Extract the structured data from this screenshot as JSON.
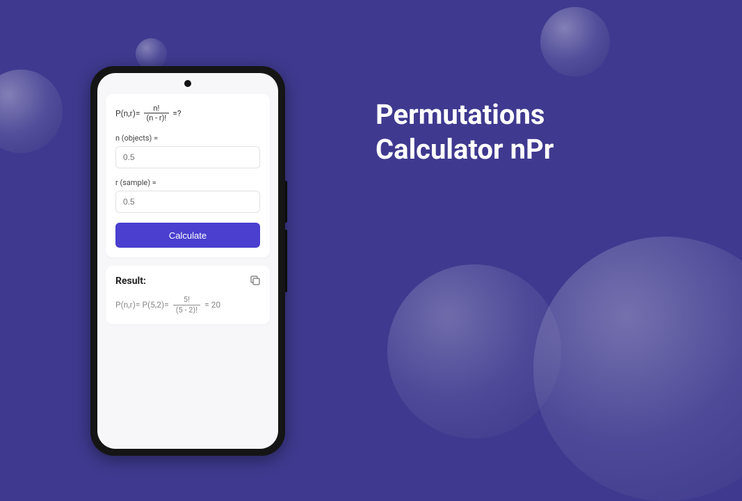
{
  "page": {
    "title_line1": "Permutations",
    "title_line2": "Calculator nPr"
  },
  "formula": {
    "prefix": "P(n,r)=",
    "numerator": "n!",
    "denominator": "(n - r)!",
    "suffix": "=?"
  },
  "inputs": {
    "n_label": "n (objects) =",
    "n_placeholder": "0.5",
    "r_label": "r (sample) =",
    "r_placeholder": "0.5"
  },
  "button": {
    "calculate": "Calculate"
  },
  "result": {
    "heading": "Result:",
    "prefix": "P(n,r)= P(5,2)=",
    "numerator": "5!",
    "denominator": "(5 - 2)!",
    "equals_value": "= 20"
  }
}
